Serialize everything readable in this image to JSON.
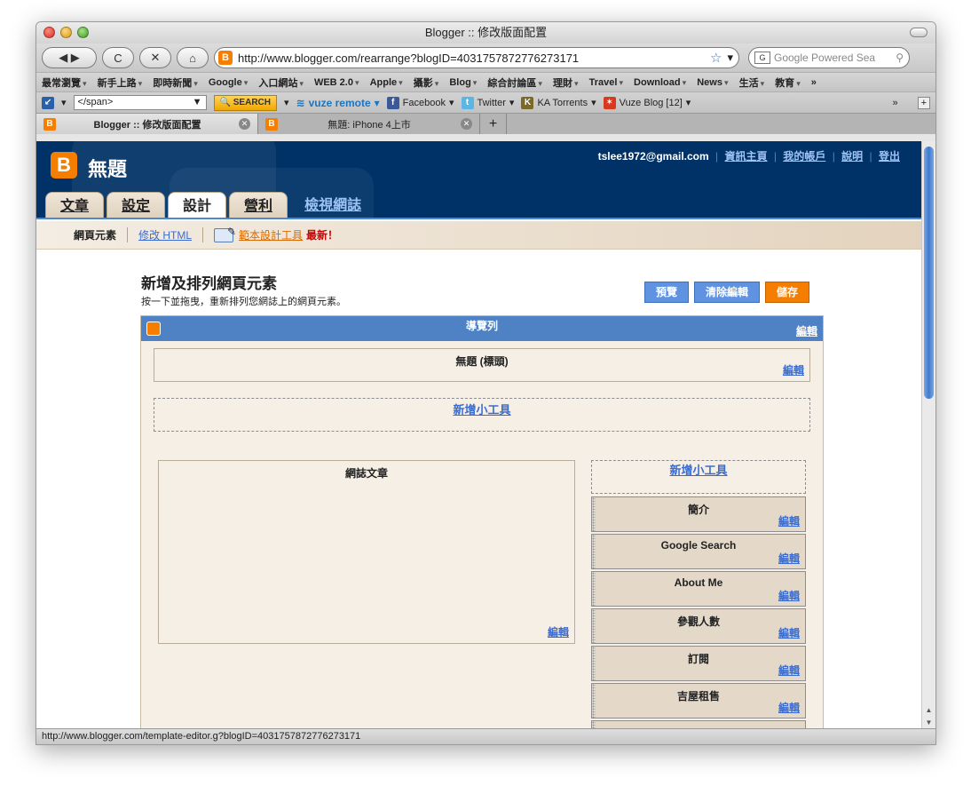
{
  "window": {
    "title": "Blogger :: 修改版面配置"
  },
  "navbar": {
    "back_glyph": "◀ ▶",
    "reload_glyph": "C",
    "stop_glyph": "✕",
    "home_glyph": "⌂",
    "url": "http://www.blogger.com/rearrange?blogID=4031757872776273171",
    "search_placeholder": "Google Powered Sea"
  },
  "bookmarks": [
    "最常瀏覽",
    "新手上路",
    "即時新聞",
    "Google",
    "入口網站",
    "WEB 2.0",
    "Apple",
    "攝影",
    "Blog",
    "綜合討論區",
    "理財",
    "Travel",
    "Download",
    "News",
    "生活",
    "教育"
  ],
  "exttoolbar": {
    "combo_value": "</span>",
    "search_label": "SEARCH",
    "vuze_label": "vuze remote",
    "facebook_label": "Facebook",
    "twitter_label": "Twitter",
    "katorrents_label": "KA Torrents",
    "vuzeblog_label": "Vuze Blog [12]",
    "more_glyph": "»",
    "add_glyph": "+"
  },
  "tabs": [
    {
      "label": "Blogger :: 修改版面配置"
    },
    {
      "label": "無題: iPhone 4上市"
    }
  ],
  "status_url": "http://www.blogger.com/template-editor.g?blogID=4031757872776273171",
  "blogger": {
    "logo_glyph": "B",
    "blog_title": "無題",
    "email": "tslee1972@gmail.com",
    "user_links": [
      "資訊主頁",
      "我的帳戶",
      "說明",
      "登出"
    ],
    "tabs": [
      "文章",
      "設定",
      "設計",
      "營利",
      "檢視網誌"
    ],
    "subnav": {
      "current": "網頁元素",
      "edit_html": "修改 HTML",
      "template_designer": "範本設計工具",
      "new_flag": "最新！"
    }
  },
  "page": {
    "title": "新增及排列網頁元素",
    "subtitle": "按一下並拖曳，重新排列您網誌上的網頁元素。",
    "buttons": {
      "preview": "預覽",
      "clear": "清除編輯",
      "save": "儲存"
    }
  },
  "layout": {
    "navbar_label": "導覽列",
    "edit_label": "編輯",
    "header_widget": "無題 (標頭)",
    "add_gadget": "新增小工具",
    "main_widget": "網誌文章",
    "sidebar_widgets": [
      "簡介",
      "Google Search",
      "About Me",
      "參觀人數",
      "訂閱",
      "吉屋租售"
    ]
  },
  "colors": {
    "header_bg": "#003267",
    "accent_orange": "#f57d00",
    "button_blue": "#5f93e2",
    "link_blue": "#3a6ccf"
  }
}
